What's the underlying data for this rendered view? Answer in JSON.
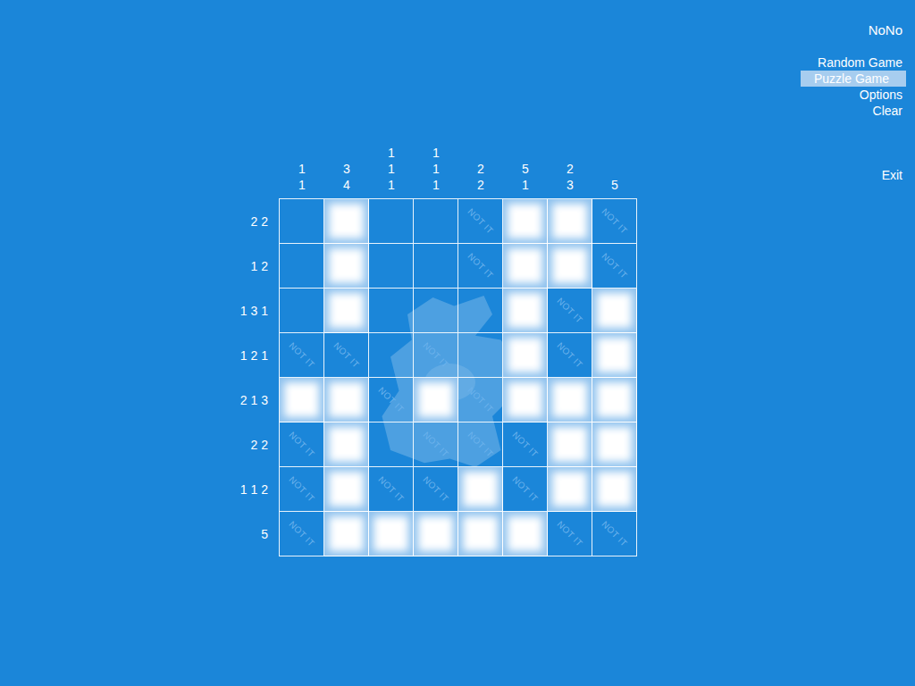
{
  "app": {
    "title": "NoNo"
  },
  "menu": [
    {
      "label": "Random Game",
      "selected": false
    },
    {
      "label": "Puzzle Game",
      "selected": true
    },
    {
      "label": "Options",
      "selected": false
    },
    {
      "label": "Clear",
      "selected": false
    }
  ],
  "exit": {
    "label": "Exit"
  },
  "puzzle": {
    "column_clues": [
      [
        "1",
        "1"
      ],
      [
        "3",
        "4"
      ],
      [
        "1",
        "1",
        "1"
      ],
      [
        "1",
        "1",
        "1"
      ],
      [
        "2",
        "2"
      ],
      [
        "5",
        "1"
      ],
      [
        "2",
        "3"
      ],
      [
        "5"
      ]
    ],
    "row_clues": [
      "2 2",
      "1 2",
      "1 3 1",
      "1 2 1",
      "2 1 3",
      "2 2",
      "1 1 2",
      "5"
    ],
    "rows": [
      [
        {
          "kind": "empty"
        },
        {
          "kind": "filled"
        },
        {
          "kind": "empty"
        },
        {
          "kind": "empty"
        },
        {
          "kind": "marked",
          "label": "NOT IT"
        },
        {
          "kind": "filled"
        },
        {
          "kind": "filled"
        },
        {
          "kind": "marked",
          "label": "NOT IT"
        }
      ],
      [
        {
          "kind": "empty"
        },
        {
          "kind": "filled"
        },
        {
          "kind": "empty"
        },
        {
          "kind": "empty"
        },
        {
          "kind": "marked",
          "label": "NOT IT"
        },
        {
          "kind": "filled"
        },
        {
          "kind": "filled"
        },
        {
          "kind": "marked",
          "label": "NOT IT"
        }
      ],
      [
        {
          "kind": "empty"
        },
        {
          "kind": "filled"
        },
        {
          "kind": "empty"
        },
        {
          "kind": "empty"
        },
        {
          "kind": "empty"
        },
        {
          "kind": "filled"
        },
        {
          "kind": "marked",
          "label": "NOT IT"
        },
        {
          "kind": "filled"
        }
      ],
      [
        {
          "kind": "marked",
          "label": "NOT IT"
        },
        {
          "kind": "marked",
          "label": "NOT IT"
        },
        {
          "kind": "empty"
        },
        {
          "kind": "marked",
          "label": "NOT IT"
        },
        {
          "kind": "empty"
        },
        {
          "kind": "filled"
        },
        {
          "kind": "marked",
          "label": "NOT IT"
        },
        {
          "kind": "filled"
        }
      ],
      [
        {
          "kind": "filled"
        },
        {
          "kind": "filled"
        },
        {
          "kind": "marked",
          "label": "NOT IT"
        },
        {
          "kind": "filled"
        },
        {
          "kind": "marked",
          "label": "NOT IT"
        },
        {
          "kind": "filled"
        },
        {
          "kind": "filled"
        },
        {
          "kind": "filled"
        }
      ],
      [
        {
          "kind": "marked",
          "label": "NOT IT"
        },
        {
          "kind": "filled"
        },
        {
          "kind": "empty"
        },
        {
          "kind": "marked",
          "label": "NOT IT"
        },
        {
          "kind": "marked",
          "label": "NOT IT"
        },
        {
          "kind": "marked",
          "label": "NOT IT"
        },
        {
          "kind": "filled"
        },
        {
          "kind": "filled"
        }
      ],
      [
        {
          "kind": "marked",
          "label": "NOT IT"
        },
        {
          "kind": "filled"
        },
        {
          "kind": "marked",
          "label": "NOT IT"
        },
        {
          "kind": "marked",
          "label": "NOT IT"
        },
        {
          "kind": "filled"
        },
        {
          "kind": "marked",
          "label": "NOT IT"
        },
        {
          "kind": "filled"
        },
        {
          "kind": "filled"
        }
      ],
      [
        {
          "kind": "marked",
          "label": "NOT IT"
        },
        {
          "kind": "filled"
        },
        {
          "kind": "filled"
        },
        {
          "kind": "filled"
        },
        {
          "kind": "filled"
        },
        {
          "kind": "filled"
        },
        {
          "kind": "marked",
          "label": "NOT IT"
        },
        {
          "kind": "marked",
          "label": "NOT IT"
        }
      ]
    ]
  }
}
